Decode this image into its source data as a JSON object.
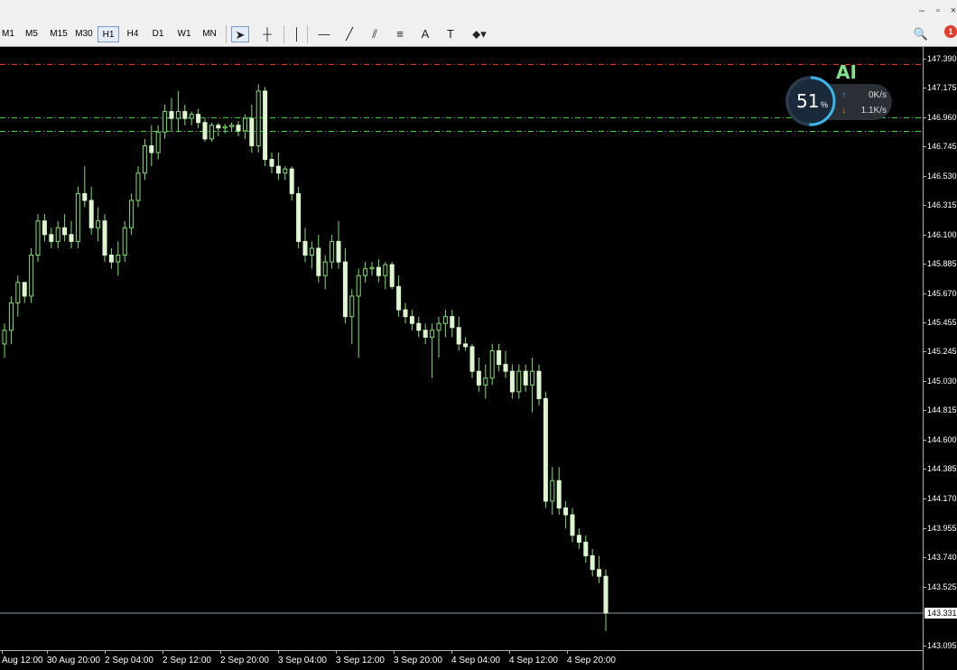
{
  "window": {
    "minimize_glyph": "–",
    "restore_glyph": "▫",
    "close_glyph": "×"
  },
  "toolbar": {
    "timeframes": [
      {
        "label": "M1",
        "active": false
      },
      {
        "label": "M5",
        "active": false
      },
      {
        "label": "M15",
        "active": false
      },
      {
        "label": "M30",
        "active": false
      },
      {
        "label": "H1",
        "active": true
      },
      {
        "label": "H4",
        "active": false
      },
      {
        "label": "D1",
        "active": false
      },
      {
        "label": "W1",
        "active": false
      },
      {
        "label": "MN",
        "active": false
      }
    ],
    "tools": [
      {
        "name": "cursor-icon",
        "glyph": "➤",
        "active": true
      },
      {
        "name": "crosshair-icon",
        "glyph": "┼",
        "active": false
      },
      {
        "name": "vertical-line-icon",
        "glyph": "│",
        "active": false
      },
      {
        "name": "horizontal-line-icon",
        "glyph": "—",
        "active": false
      },
      {
        "name": "trendline-icon",
        "glyph": "╱",
        "active": false
      },
      {
        "name": "channel-icon",
        "glyph": "⫽",
        "active": false
      },
      {
        "name": "fibonacci-icon",
        "glyph": "≡",
        "active": false
      },
      {
        "name": "text-icon",
        "glyph": "A",
        "active": false
      },
      {
        "name": "text-label-icon",
        "glyph": "T",
        "active": false
      },
      {
        "name": "objects-menu-icon",
        "glyph": "⬥▾",
        "active": false
      }
    ],
    "search_glyph": "🔍",
    "alert_count": "1"
  },
  "chart": {
    "background": "#000000",
    "up_color": "#dff7d0",
    "down_color": "#dff7d0",
    "wick_color": "#7ee06c",
    "level_lines": [
      {
        "price": 147.345,
        "color": "#ff3b1f",
        "style": "dash-dot"
      },
      {
        "price": 146.955,
        "color": "#3cd93c",
        "style": "dash-dot"
      },
      {
        "price": 146.855,
        "color": "#3cd93c",
        "style": "dash-dot"
      }
    ],
    "bid_price": "143.331",
    "bid_value": 143.331,
    "price_labels": [
      "147.390",
      "147.175",
      "146.960",
      "146.745",
      "146.530",
      "146.315",
      "146.100",
      "145.885",
      "145.670",
      "145.455",
      "145.245",
      "145.030",
      "144.815",
      "144.600",
      "144.385",
      "144.170",
      "143.955",
      "143.740",
      "143.525",
      "143.095"
    ],
    "time_labels": [
      "Aug 12:00",
      "30 Aug 20:00",
      "2 Sep 04:00",
      "2 Sep 12:00",
      "2 Sep 20:00",
      "3 Sep 04:00",
      "3 Sep 12:00",
      "3 Sep 20:00",
      "4 Sep 04:00",
      "4 Sep 12:00",
      "4 Sep 20:00"
    ]
  },
  "ai_widget": {
    "title": "AI",
    "percent": "51",
    "percent_unit": "%",
    "upload_speed": "0K/s",
    "download_speed": "1.1K/s"
  },
  "chart_data": {
    "type": "candlestick",
    "timeframe": "H1",
    "ylim": [
      143.0,
      147.45
    ],
    "candles": [
      [
        145.3,
        145.45,
        145.2,
        145.4
      ],
      [
        145.4,
        145.65,
        145.3,
        145.6
      ],
      [
        145.6,
        145.8,
        145.5,
        145.75
      ],
      [
        145.75,
        145.7,
        145.6,
        145.65
      ],
      [
        145.65,
        146.0,
        145.6,
        145.95
      ],
      [
        145.95,
        146.25,
        145.9,
        146.2
      ],
      [
        146.2,
        146.25,
        146.05,
        146.1
      ],
      [
        146.1,
        146.15,
        146.0,
        146.05
      ],
      [
        146.05,
        146.2,
        146.0,
        146.15
      ],
      [
        146.15,
        146.25,
        146.05,
        146.1
      ],
      [
        146.1,
        146.2,
        146.0,
        146.05
      ],
      [
        146.05,
        146.45,
        146.0,
        146.4
      ],
      [
        146.4,
        146.6,
        146.3,
        146.35
      ],
      [
        146.35,
        146.45,
        146.1,
        146.15
      ],
      [
        146.15,
        146.3,
        146.05,
        146.2
      ],
      [
        146.2,
        146.25,
        145.9,
        145.95
      ],
      [
        145.95,
        146.0,
        145.85,
        145.9
      ],
      [
        145.9,
        146.05,
        145.8,
        145.95
      ],
      [
        145.95,
        146.2,
        145.9,
        146.15
      ],
      [
        146.15,
        146.4,
        146.1,
        146.35
      ],
      [
        146.35,
        146.6,
        146.3,
        146.55
      ],
      [
        146.55,
        146.8,
        146.5,
        146.75
      ],
      [
        146.75,
        146.9,
        146.6,
        146.7
      ],
      [
        146.7,
        146.9,
        146.65,
        146.85
      ],
      [
        146.85,
        147.05,
        146.8,
        147.0
      ],
      [
        147.0,
        147.1,
        146.85,
        146.95
      ],
      [
        146.95,
        147.15,
        146.85,
        147.0
      ],
      [
        147.0,
        147.05,
        146.9,
        146.95
      ],
      [
        146.95,
        147.0,
        146.9,
        146.98
      ],
      [
        146.98,
        147.02,
        146.88,
        146.92
      ],
      [
        146.92,
        146.95,
        146.78,
        146.8
      ],
      [
        146.8,
        146.92,
        146.78,
        146.9
      ],
      [
        146.9,
        146.92,
        146.82,
        146.88
      ],
      [
        146.88,
        146.91,
        146.84,
        146.89
      ],
      [
        146.89,
        146.92,
        146.85,
        146.9
      ],
      [
        146.9,
        146.93,
        146.82,
        146.86
      ],
      [
        146.86,
        146.98,
        146.8,
        146.95
      ],
      [
        146.95,
        147.05,
        146.7,
        146.75
      ],
      [
        146.75,
        147.2,
        146.7,
        147.15
      ],
      [
        147.15,
        147.18,
        146.6,
        146.65
      ],
      [
        146.65,
        146.7,
        146.55,
        146.6
      ],
      [
        146.6,
        146.7,
        146.5,
        146.55
      ],
      [
        146.55,
        146.6,
        146.5,
        146.58
      ],
      [
        146.58,
        146.6,
        146.35,
        146.4
      ],
      [
        146.4,
        146.45,
        146.0,
        146.05
      ],
      [
        146.05,
        146.15,
        145.9,
        145.95
      ],
      [
        145.95,
        146.05,
        145.85,
        146.0
      ],
      [
        146.0,
        146.1,
        145.75,
        145.8
      ],
      [
        145.8,
        145.95,
        145.7,
        145.9
      ],
      [
        145.9,
        146.1,
        145.85,
        146.05
      ],
      [
        146.05,
        146.2,
        145.85,
        145.9
      ],
      [
        145.9,
        146.0,
        145.45,
        145.5
      ],
      [
        145.5,
        145.7,
        145.3,
        145.65
      ],
      [
        145.65,
        145.85,
        145.2,
        145.8
      ],
      [
        145.8,
        145.9,
        145.75,
        145.85
      ],
      [
        145.85,
        145.9,
        145.8,
        145.86
      ],
      [
        145.86,
        145.92,
        145.75,
        145.8
      ],
      [
        145.8,
        145.9,
        145.7,
        145.88
      ],
      [
        145.88,
        145.9,
        145.7,
        145.72
      ],
      [
        145.72,
        145.8,
        145.5,
        145.55
      ],
      [
        145.55,
        145.6,
        145.45,
        145.5
      ],
      [
        145.5,
        145.55,
        145.4,
        145.45
      ],
      [
        145.45,
        145.5,
        145.35,
        145.4
      ],
      [
        145.4,
        145.45,
        145.3,
        145.35
      ],
      [
        145.35,
        145.45,
        145.05,
        145.4
      ],
      [
        145.4,
        145.5,
        145.2,
        145.45
      ],
      [
        145.45,
        145.55,
        145.35,
        145.5
      ],
      [
        145.5,
        145.55,
        145.35,
        145.42
      ],
      [
        145.42,
        145.5,
        145.25,
        145.3
      ],
      [
        145.3,
        145.35,
        145.25,
        145.28
      ],
      [
        145.28,
        145.3,
        145.05,
        145.1
      ],
      [
        145.1,
        145.2,
        144.95,
        145.0
      ],
      [
        145.0,
        145.15,
        144.9,
        145.05
      ],
      [
        145.05,
        145.3,
        145.0,
        145.25
      ],
      [
        145.25,
        145.3,
        145.1,
        145.15
      ],
      [
        145.15,
        145.25,
        145.05,
        145.1
      ],
      [
        145.1,
        145.15,
        144.9,
        144.95
      ],
      [
        144.95,
        145.15,
        144.9,
        145.1
      ],
      [
        145.1,
        145.15,
        144.95,
        145.0
      ],
      [
        145.0,
        145.2,
        144.8,
        145.1
      ],
      [
        145.1,
        145.15,
        144.85,
        144.9
      ],
      [
        144.9,
        144.95,
        144.1,
        144.15
      ],
      [
        144.15,
        144.4,
        144.05,
        144.3
      ],
      [
        144.3,
        144.4,
        144.05,
        144.1
      ],
      [
        144.1,
        144.15,
        143.95,
        144.05
      ],
      [
        144.05,
        144.1,
        143.85,
        143.9
      ],
      [
        143.9,
        143.95,
        143.8,
        143.85
      ],
      [
        143.85,
        143.9,
        143.7,
        143.75
      ],
      [
        143.75,
        143.8,
        143.6,
        143.65
      ],
      [
        143.65,
        143.75,
        143.55,
        143.6
      ],
      [
        143.6,
        143.65,
        143.2,
        143.331
      ]
    ],
    "level_lines": [
      147.345,
      146.955,
      146.855
    ],
    "bid": 143.331
  }
}
